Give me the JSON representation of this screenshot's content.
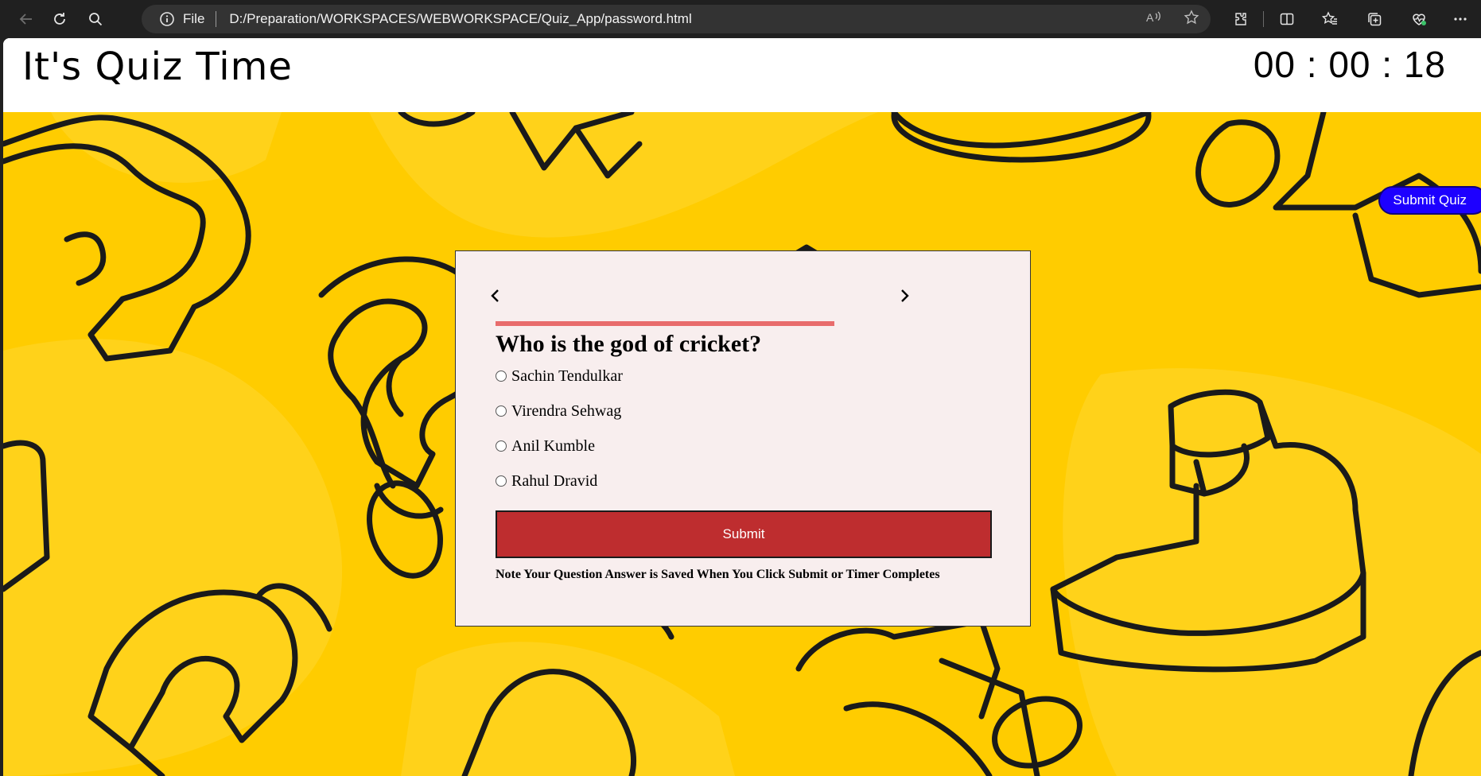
{
  "browser": {
    "scheme_label": "File",
    "url": "D:/Preparation/WORKSPACES/WEBWORKSPACE/Quiz_App/password.html",
    "icons": [
      "back-icon",
      "refresh-icon",
      "search-icon",
      "info-icon",
      "read-aloud-icon",
      "favorite-star-icon",
      "extensions-icon",
      "split-screen-icon",
      "favorites-icon",
      "collections-icon",
      "browser-essentials-icon",
      "more-icon"
    ]
  },
  "header": {
    "title": "It's Quiz Time",
    "timer": "00 : 00 : 18"
  },
  "actions": {
    "submit_quiz_label": "Submit Quiz"
  },
  "quiz": {
    "prev_icon": "chevron-left-icon",
    "next_icon": "chevron-right-icon",
    "progress": 1.0,
    "question": "Who is the god of cricket?",
    "options": [
      {
        "label": "Sachin Tendulkar",
        "selected": false
      },
      {
        "label": "Virendra Sehwag",
        "selected": false
      },
      {
        "label": "Anil Kumble",
        "selected": false
      },
      {
        "label": "Rahul Dravid",
        "selected": false
      }
    ],
    "submit_label": "Submit",
    "note": "Note Your Question Answer is Saved When You Click Submit or Timer Completes"
  },
  "colors": {
    "background": "#ffcc00",
    "card": "#f8eeee",
    "submit_button": "#be2d2f",
    "progress": "#e86c6c",
    "submit_quiz_button": "#1d00ff"
  }
}
